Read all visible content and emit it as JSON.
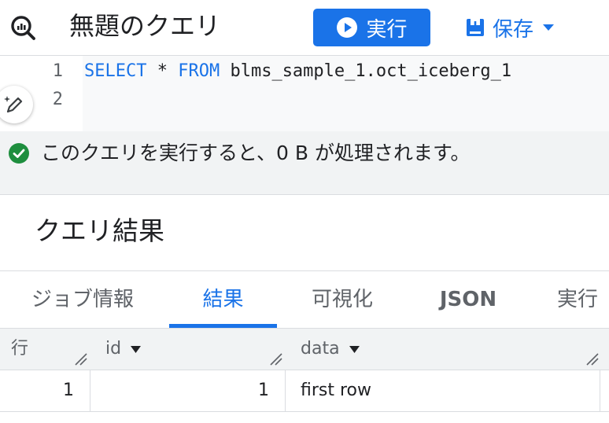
{
  "header": {
    "title": "無題のクエリ",
    "run_label": "実行",
    "save_label": "保存"
  },
  "editor": {
    "line_numbers": [
      "1",
      "2"
    ],
    "line1": {
      "kw1": "SELECT",
      "star": " * ",
      "kw2": "FROM",
      "rest": " blms_sample_1.oct_iceberg_1"
    }
  },
  "status": {
    "text": "このクエリを実行すると、0 B が処理されます。"
  },
  "results": {
    "title": "クエリ結果",
    "tabs": [
      {
        "label": "ジョブ情報",
        "active": false
      },
      {
        "label": "結果",
        "active": true
      },
      {
        "label": "可視化",
        "active": false
      },
      {
        "label": "JSON",
        "active": false
      },
      {
        "label": "実行",
        "active": false
      }
    ],
    "columns": [
      "行",
      "id",
      "data"
    ],
    "rows": [
      {
        "row": "1",
        "id": "1",
        "data": "first row"
      }
    ]
  },
  "colors": {
    "accent": "#1a73e8",
    "success": "#1e8e3e"
  },
  "icons": [
    "query-icon",
    "play-icon",
    "save-icon",
    "chevron-down-icon",
    "ai-pen-icon",
    "check-circle-icon",
    "resize-handle-icon"
  ]
}
